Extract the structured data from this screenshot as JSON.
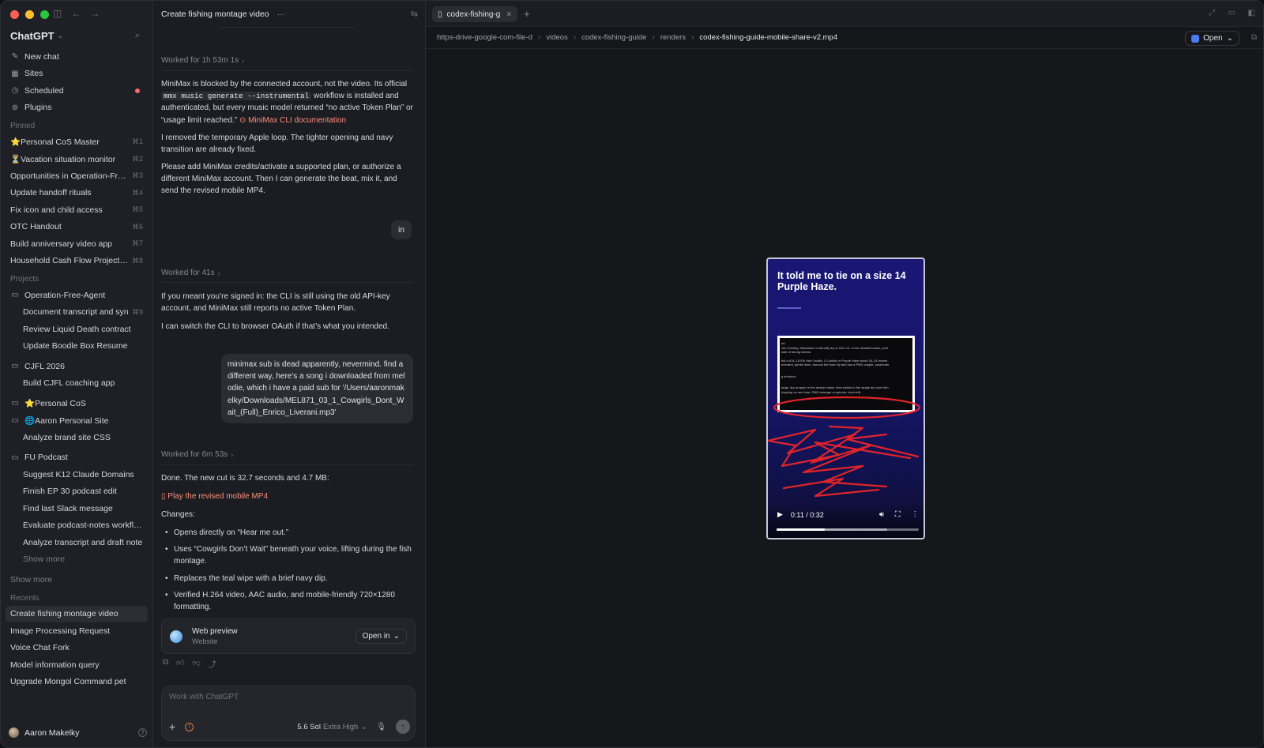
{
  "sidebar": {
    "brand": "ChatGPT",
    "nav": [
      {
        "label": "New chat",
        "icon": "compose-icon"
      },
      {
        "label": "Sites",
        "icon": "grid-icon"
      },
      {
        "label": "Scheduled",
        "icon": "clock-icon",
        "badge": true
      },
      {
        "label": "Plugins",
        "icon": "plug-icon"
      }
    ],
    "pinned_header": "Pinned",
    "pinned": [
      {
        "label": "⭐Personal CoS Master",
        "shortcut": "⌘1"
      },
      {
        "label": "⏳Vacation situation monitor",
        "shortcut": "⌘2"
      },
      {
        "label": "Opportunities in Operation-Free-",
        "shortcut": "⌘3"
      },
      {
        "label": "Update handoff rituals",
        "shortcut": "⌘4"
      },
      {
        "label": "Fix icon and child access",
        "shortcut": "⌘5"
      },
      {
        "label": "OTC Handout",
        "shortcut": "⌘6"
      },
      {
        "label": "Build anniversary video app",
        "shortcut": "⌘7"
      },
      {
        "label": "Household Cash Flow Projection",
        "shortcut": "⌘8"
      }
    ],
    "projects_header": "Projects",
    "projects": {
      "p1": {
        "name": "Operation-Free-Agent",
        "items": [
          {
            "label": "Document transcript and syn",
            "shortcut": "⌘9"
          },
          {
            "label": "Review Liquid Death contract"
          },
          {
            "label": "Update Boodle Box Resume"
          }
        ]
      },
      "p2": {
        "name": "CJFL 2026",
        "items": [
          {
            "label": "Build CJFL coaching app"
          }
        ]
      },
      "p3": {
        "name": "⭐Personal CoS"
      },
      "p4": {
        "name": "🌐Aaron Personal Site",
        "items": [
          {
            "label": "Analyze brand site CSS"
          }
        ]
      },
      "p5": {
        "name": "FU Podcast",
        "items": [
          {
            "label": "Suggest K12 Claude Domains"
          },
          {
            "label": "Finish EP 30 podcast edit"
          },
          {
            "label": "Find last Slack message"
          },
          {
            "label": "Evaluate podcast-notes workflow"
          },
          {
            "label": "Analyze transcript and draft note"
          }
        ]
      }
    },
    "show_more_inner": "Show more",
    "show_more": "Show more",
    "recents_header": "Recents",
    "recents": [
      "Create fishing montage video",
      "Image Processing Request",
      "Voice Chat Fork",
      "Model information query",
      "Upgrade Mongol Command pet"
    ],
    "user_name": "Aaron Makelky"
  },
  "chat": {
    "title": "Create fishing montage video",
    "worked1": "Worked for 1h 53m 1s",
    "msg1_a": "MiniMax is blocked by the connected account, not the video. Its official",
    "msg1_code": "mmx music generate --instrumental",
    "msg1_b": "workflow is installed and authenticated, but every music model returned “no active Token Plan” or “usage limit reached.”",
    "msg1_link": "MiniMax CLI documentation",
    "msg2": "I removed the temporary Apple loop. The tighter opening and navy transition are already fixed.",
    "msg3": "Please add MiniMax credits/activate a supported plan, or authorize a different MiniMax account. Then I can generate the beat, mix it, and send the revised mobile MP4.",
    "user_short": "in",
    "worked2": "Worked for 41s",
    "msg4": "If you meant you’re signed in: the CLI is still using the old API-key account, and MiniMax still reports no active Token Plan.",
    "msg5": "I can switch the CLI to browser OAuth if that’s what you intended.",
    "user_long": "minimax sub is dead apparently, nevermind. find a different way, here's a song i downloaded from melodie, which i have a paid sub for '/Users/aaronmakelky/Downloads/MEL871_03_1_Cowgirls_Dont_Wait_(Full)_Enrico_Liverani.mp3'",
    "worked3": "Worked for 6m 53s",
    "msg6": "Done. The new cut is 32.7 seconds and 4.7 MB:",
    "msg6_link": "Play the revised mobile MP4",
    "changes_label": "Changes:",
    "changes": [
      "Opens directly on “Hear me out.”",
      "Uses “Cowgirls Don’t Wait” beneath your voice, lifting during the fish montage.",
      "Replaces the teal wipe with a brief navy dip.",
      "Verified H.264 video, AAC audio, and mobile-friendly 720×1280 formatting."
    ],
    "webcard_title": "Web preview",
    "webcard_sub": "Website",
    "webcard_btn": "Open in",
    "composer_placeholder": "Work with ChatGPT",
    "model": "5.6 Sol",
    "effort": "Extra High"
  },
  "viewer": {
    "tab_label": "codex-fishing-g",
    "breadcrumb": [
      "https-drive-google-com-file-d",
      "videos",
      "codex-fishing-guide",
      "renders",
      "codex-fishing-guide-mobile-share-v2.mp4"
    ],
    "open_label": "Open",
    "video": {
      "title": "It told me to tie on a size 14 Purple Haze.",
      "frame_lines": [
        "ort",
        "Jon Chubby, Stimulator or stonefly dry in #10–14. Cover shaded banks, pool",
        "side of strong seams.",
        "",
        "ttal a #14–18 Elk Hair Caddis, X-Caddis or Purple Haze about 18–24 inches",
        "entrated, gentle rises, remove the foam fly and use a PMD cripple, parachute",
        "",
        "g shortcut:",
        "",
        "ange, dry-dropper in the deeper water, then switch to the single dry once fish",
        "hopping on one lone, PMD emerger or spinner, dont drift."
      ],
      "time": "0:11 / 0:32",
      "progress": 0.34,
      "buffered": 0.78
    }
  }
}
